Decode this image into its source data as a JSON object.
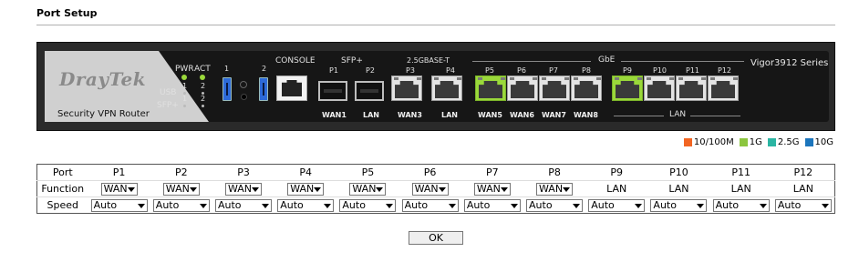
{
  "page": {
    "title": "Port Setup"
  },
  "router": {
    "brand": "DrayTek",
    "subtitle": "Security VPN Router",
    "model": "Vigor3912 Series",
    "labels": {
      "pwr": "PWR",
      "act": "ACT",
      "usb": "USB",
      "sfp": "SFP+",
      "one": "1",
      "two": "2",
      "console": "CONSOLE",
      "sfp_group": "SFP+",
      "base_t_group": "2.5GBASE-T",
      "gbe_group": "GbE",
      "lan_group": "LAN"
    },
    "port_top_labels": [
      "P1",
      "P2",
      "P3",
      "P4",
      "P5",
      "P6",
      "P7",
      "P8",
      "P9",
      "P10",
      "P11",
      "P12"
    ],
    "port_bottom_labels": [
      "WAN1",
      "LAN",
      "WAN3",
      "LAN",
      "WAN5",
      "WAN6",
      "WAN7",
      "WAN8"
    ],
    "usb_labels": [
      "1",
      "2"
    ]
  },
  "legend": [
    {
      "label": "10/100M",
      "color": "#f26522"
    },
    {
      "label": "1G",
      "color": "#8cc63f"
    },
    {
      "label": "2.5G",
      "color": "#2bb5a3"
    },
    {
      "label": "10G",
      "color": "#1c75bc"
    }
  ],
  "table": {
    "row_labels": {
      "port": "Port",
      "function": "Function",
      "speed": "Speed"
    },
    "ports": [
      "P1",
      "P2",
      "P3",
      "P4",
      "P5",
      "P6",
      "P7",
      "P8",
      "P9",
      "P10",
      "P11",
      "P12"
    ],
    "functions": [
      "WAN",
      "WAN",
      "WAN",
      "WAN",
      "WAN",
      "WAN",
      "WAN",
      "WAN",
      "LAN",
      "LAN",
      "LAN",
      "LAN"
    ],
    "function_is_select": [
      true,
      true,
      true,
      true,
      true,
      true,
      true,
      true,
      false,
      false,
      false,
      false
    ],
    "speeds": [
      "Auto",
      "Auto",
      "Auto",
      "Auto",
      "Auto",
      "Auto",
      "Auto",
      "Auto",
      "Auto",
      "Auto",
      "Auto",
      "Auto"
    ]
  },
  "ok_label": "OK"
}
